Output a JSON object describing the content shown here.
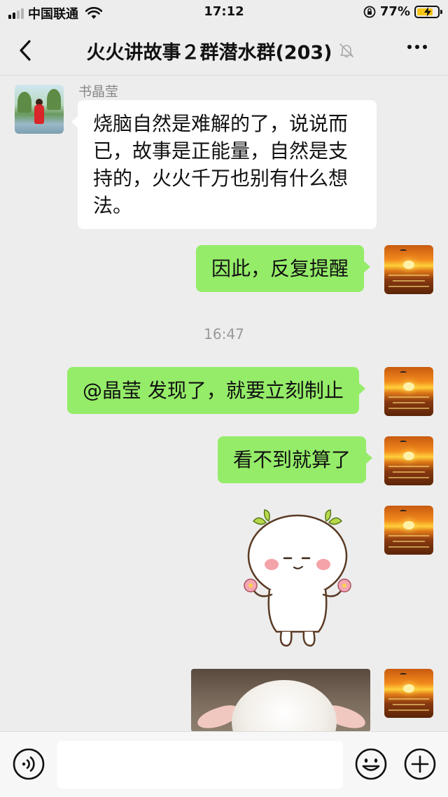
{
  "status_bar": {
    "carrier": "中国联通",
    "time": "17:12",
    "battery_percent": "77%",
    "battery_level": 0.77,
    "signal_icon": "signal-icon",
    "wifi_icon": "wifi-icon",
    "lock_icon": "orientation-lock-icon",
    "battery_icon": "battery-charging-icon"
  },
  "nav": {
    "back_icon": "back-icon",
    "title": "火火讲故事２群潜水群(203)",
    "mute_icon": "mute-bell-icon",
    "more_icon": "more-icon"
  },
  "messages": {
    "m1": {
      "sender": "书晶莹",
      "text": "烧脑自然是难解的了，说说而已，故事是正能量，自然是支持的，火火千万也别有什么想法。"
    },
    "m2": {
      "text": "因此，反复提醒"
    },
    "timestamp": "16:47",
    "m3": {
      "text": "@晶莹 发现了，就要立刻制止"
    },
    "m4": {
      "text": "看不到就算了"
    },
    "m5": {
      "type": "sticker",
      "icon": "cute-bun-sticker-icon"
    },
    "m6": {
      "type": "image"
    }
  },
  "input_bar": {
    "voice_icon": "voice-icon",
    "input_value": "",
    "emoji_icon": "emoji-icon",
    "plus_icon": "plus-icon"
  },
  "colors": {
    "background": "#ededed",
    "outgoing_bubble": "#95ec69",
    "incoming_bubble": "#ffffff"
  }
}
